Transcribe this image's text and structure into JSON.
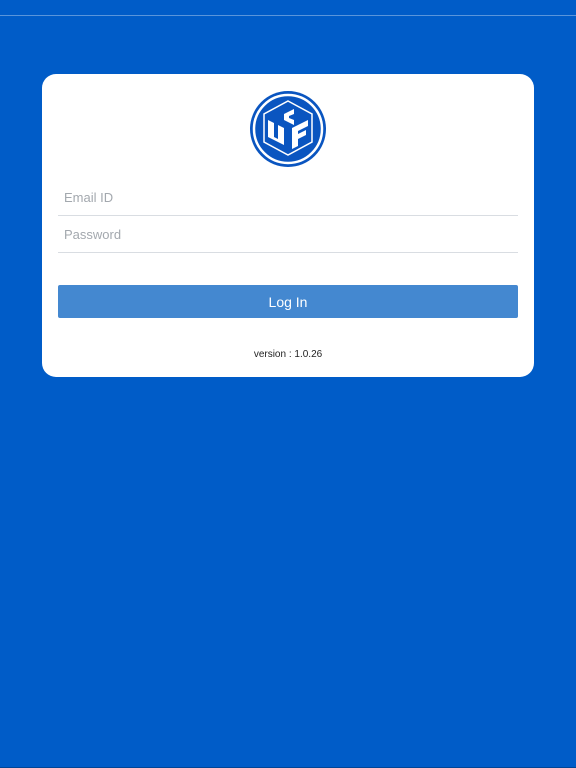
{
  "login": {
    "email_placeholder": "Email ID",
    "email_value": "",
    "password_placeholder": "Password",
    "password_value": "",
    "login_label": "Log In",
    "version_text": "version : 1.0.26"
  },
  "logo": {
    "icon": "cube-logo-icon",
    "letters": "UCF",
    "primary_color": "#0a55c0",
    "accent_color": "#ffffff"
  },
  "colors": {
    "background": "#005cc8",
    "card": "#ffffff",
    "button": "#4488d0",
    "button_text": "#ffffff"
  }
}
